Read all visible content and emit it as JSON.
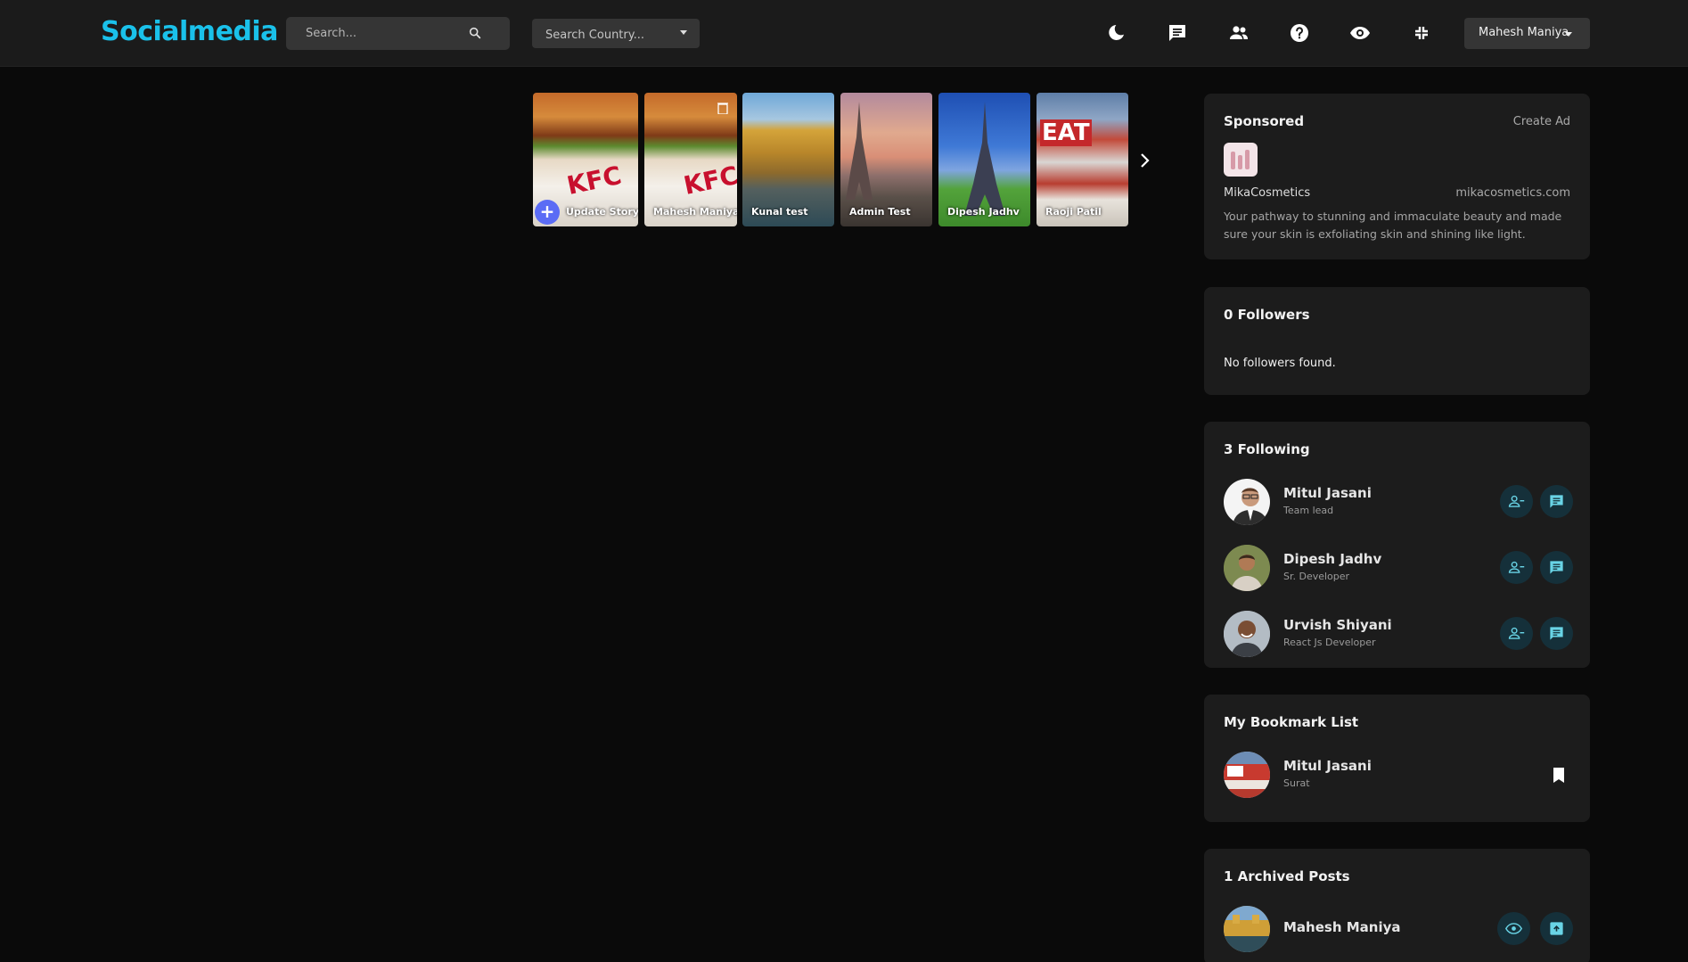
{
  "brand": "Socialmedia",
  "search": {
    "placeholder": "Search..."
  },
  "country": {
    "placeholder": "Search Country..."
  },
  "nav_icons": [
    "moon-icon",
    "chat-icon",
    "people-icon",
    "help-icon",
    "eye-icon",
    "fullscreen-exit-icon"
  ],
  "user_menu": {
    "label": "Mahesh Maniya"
  },
  "stories": [
    {
      "label": "Update Story"
    },
    {
      "label": "Mahesh Maniya"
    },
    {
      "label": "Kunal test"
    },
    {
      "label": "Admin Test"
    },
    {
      "label": "Dipesh Jadhv"
    },
    {
      "label": "Raoji Patil"
    }
  ],
  "sponsored": {
    "title": "Sponsored",
    "create_label": "Create Ad",
    "name": "MikaCosmetics",
    "url": "mikacosmetics.com",
    "description": "Your pathway to stunning and immaculate beauty and made sure your skin is exfoliating skin and shining like light."
  },
  "followers": {
    "title": "0 Followers",
    "empty": "No followers found."
  },
  "following": {
    "title": "3 Following",
    "people": [
      {
        "name": "Mitul Jasani",
        "role": "Team lead"
      },
      {
        "name": "Dipesh Jadhv",
        "role": "Sr. Developer"
      },
      {
        "name": "Urvish Shiyani",
        "role": "React Js Developer"
      }
    ]
  },
  "bookmarks": {
    "title": "My Bookmark List",
    "items": [
      {
        "name": "Mitul Jasani",
        "location": "Surat"
      }
    ]
  },
  "archived": {
    "title": "1 Archived Posts",
    "items": [
      {
        "name": "Mahesh Maniya"
      }
    ]
  },
  "colors": {
    "brand": "#1ac1ea",
    "accent_button": "#15303a",
    "story_add": "#5b6cf5"
  }
}
